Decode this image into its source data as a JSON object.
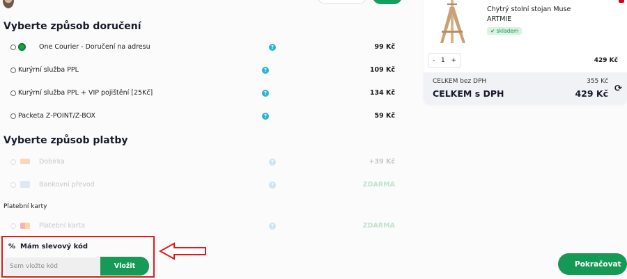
{
  "header": {
    "user_text": ""
  },
  "shipping": {
    "title": "Vyberte způsob doručení",
    "options": [
      {
        "label": "One Courier - Doručení na adresu",
        "price": "99 Kč",
        "icon": "one-courier-logo"
      },
      {
        "label": "Kurýrní služba PPL",
        "price": "109 Kč"
      },
      {
        "label": "Kurýrní služba PPL + VIP pojištění [25Kč]",
        "price": "134 Kč"
      },
      {
        "label": "Packeta Z-POINT/Z-BOX",
        "price": "59 Kč"
      }
    ]
  },
  "payment": {
    "title": "Vyberte způsob platby",
    "options": [
      {
        "label": "Dobírka",
        "price": "+39 Kč",
        "icon": "cash-on-delivery-icon"
      },
      {
        "label": "Bankovní převod",
        "price": "ZDARMA",
        "icon": "bank-transfer-icon"
      }
    ],
    "cards_heading": "Platební karty",
    "card_option": {
      "label": "Platební karta",
      "price": "ZDARMA",
      "icon": "payment-card-icon"
    }
  },
  "discount": {
    "icon": "%",
    "title": "Mám slevový kód",
    "placeholder": "Sem vložte kód",
    "button": "Vložit"
  },
  "cart": {
    "product_name_line1": "Chytrý stolní stojan Muse",
    "product_name_line2": "ARTMIE",
    "stock": "✔ skladem",
    "qty_minus": "-",
    "qty_value": "1",
    "qty_plus": "+",
    "item_price": "429 Kč",
    "total_ex_vat_label": "CELKEM bez DPH",
    "total_ex_vat": "355 Kč",
    "total_vat_label": "CELKEM s DPH",
    "total_vat": "429 Kč",
    "refresh_icon": "⟳"
  },
  "actions": {
    "continue": "Pokračovat"
  },
  "colors": {
    "accent_green": "#16a05e",
    "highlight_red": "#e01b1b",
    "help_blue": "#2bb1d6"
  }
}
